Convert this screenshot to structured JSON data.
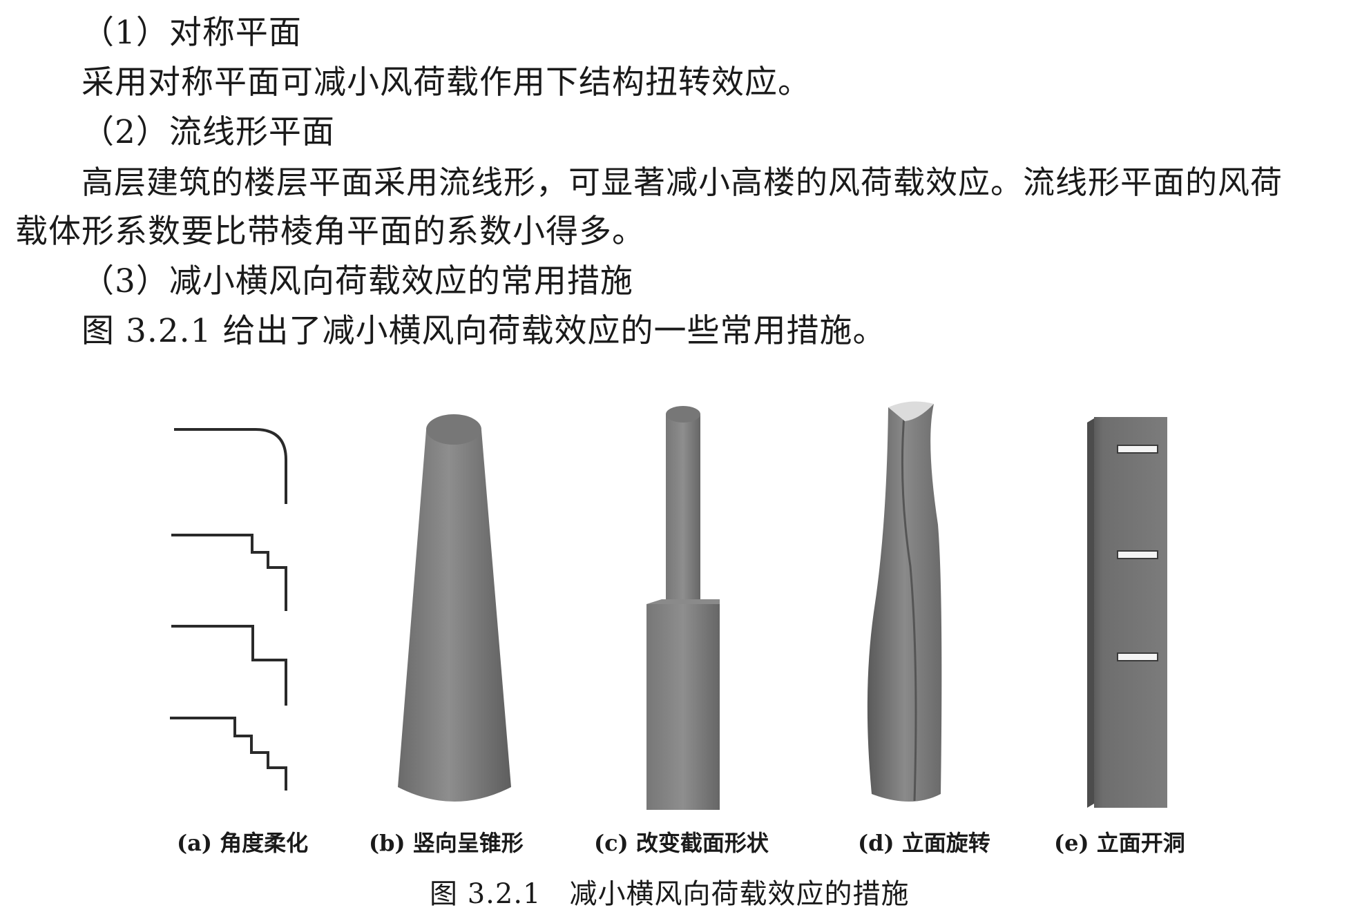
{
  "text": {
    "heading1": "（1）对称平面",
    "para1": "采用对称平面可减小风荷载作用下结构扭转效应。",
    "heading2": "（2）流线形平面",
    "para2_line1": "高层建筑的楼层平面采用流线形，可显著减小高楼的风荷载效应。流线形平面的风荷",
    "para2_line2": "载体形系数要比带棱角平面的系数小得多。",
    "heading3": "（3）减小横风向荷载效应的常用措施",
    "para3": "图 3.2.1 给出了减小横风向荷载效应的一些常用措施。"
  },
  "figure": {
    "captions": {
      "a": "(a) 角度柔化",
      "b": "(b) 竖向呈锥形",
      "c": "(c) 改变截面形状",
      "d": "(d) 立面旋转",
      "e": "(e) 立面开洞"
    },
    "title": "图 3.2.1　减小横风向荷载效应的措施"
  }
}
